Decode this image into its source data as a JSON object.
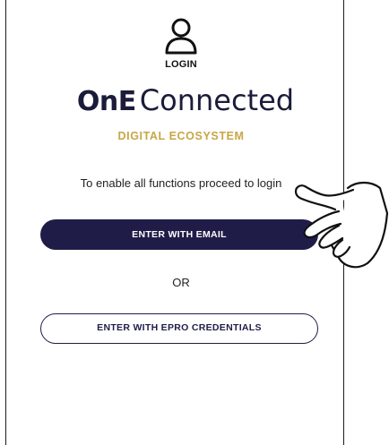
{
  "header": {
    "login_label": "LOGIN",
    "user_icon": "user-icon"
  },
  "brand": {
    "one": "OnE",
    "connected": "Connected",
    "tagline": "DIGITAL ECOSYSTEM",
    "tagline_color": "#c8a646",
    "primary_color": "#1f1d48"
  },
  "main": {
    "instruction": "To enable all functions proceed to login",
    "email_button_label": "ENTER WITH EMAIL",
    "or_label": "OR",
    "epro_button_label": "ENTER WITH EPRO CREDENTIALS"
  },
  "overlay": {
    "pointer_icon": "pointing-hand-icon"
  }
}
